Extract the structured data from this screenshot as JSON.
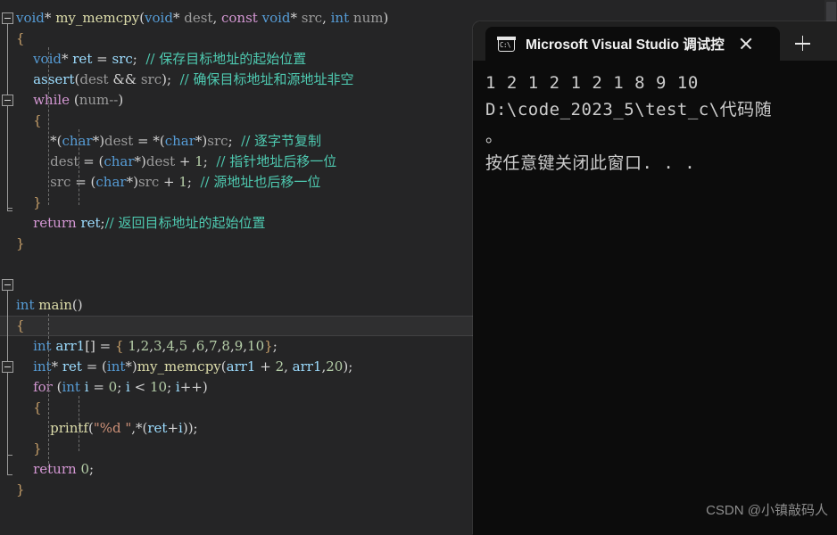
{
  "editor": {
    "name": "visual-studio-code-editor",
    "theme_background": "#252526",
    "current_line_index": 15,
    "lines": [
      {
        "indent": 0,
        "tokens": [
          {
            "c": "t-type",
            "s": "void"
          },
          {
            "c": "t-punct",
            "s": "* "
          },
          {
            "c": "t-fn",
            "s": "my_memcpy"
          },
          {
            "c": "t-punct",
            "s": "("
          },
          {
            "c": "t-type",
            "s": "void"
          },
          {
            "c": "t-punct",
            "s": "* "
          },
          {
            "c": "t-ident",
            "s": "dest"
          },
          {
            "c": "t-punct",
            "s": ", "
          },
          {
            "c": "t-key",
            "s": "const"
          },
          {
            "c": "t-punct",
            "s": " "
          },
          {
            "c": "t-type",
            "s": "void"
          },
          {
            "c": "t-punct",
            "s": "* "
          },
          {
            "c": "t-ident",
            "s": "src"
          },
          {
            "c": "t-punct",
            "s": ", "
          },
          {
            "c": "t-type",
            "s": "int"
          },
          {
            "c": "t-punct",
            "s": " "
          },
          {
            "c": "t-ident",
            "s": "num"
          },
          {
            "c": "t-punct",
            "s": ")"
          }
        ]
      },
      {
        "indent": 0,
        "tokens": [
          {
            "c": "t-brace",
            "s": "{"
          }
        ]
      },
      {
        "indent": 0,
        "tokens": [
          {
            "c": "t-punct",
            "s": "    "
          },
          {
            "c": "t-type",
            "s": "void"
          },
          {
            "c": "t-punct",
            "s": "* "
          },
          {
            "c": "t-var",
            "s": "ret"
          },
          {
            "c": "t-punct",
            "s": " = "
          },
          {
            "c": "t-var",
            "s": "src"
          },
          {
            "c": "t-punct",
            "s": ";  "
          },
          {
            "c": "t-cmt",
            "s": "// 保存目标地址的起始位置"
          }
        ]
      },
      {
        "indent": 0,
        "tokens": [
          {
            "c": "t-punct",
            "s": "    "
          },
          {
            "c": "t-var",
            "s": "assert"
          },
          {
            "c": "t-punct",
            "s": "("
          },
          {
            "c": "t-ident",
            "s": "dest"
          },
          {
            "c": "t-punct",
            "s": " && "
          },
          {
            "c": "t-ident",
            "s": "src"
          },
          {
            "c": "t-punct",
            "s": ");  "
          },
          {
            "c": "t-cmt",
            "s": "// 确保目标地址和源地址非空"
          }
        ]
      },
      {
        "indent": 0,
        "tokens": [
          {
            "c": "t-punct",
            "s": "    "
          },
          {
            "c": "t-key",
            "s": "while"
          },
          {
            "c": "t-punct",
            "s": " ("
          },
          {
            "c": "t-ident",
            "s": "num--"
          },
          {
            "c": "t-punct",
            "s": ")"
          }
        ]
      },
      {
        "indent": 0,
        "tokens": [
          {
            "c": "t-punct",
            "s": "    "
          },
          {
            "c": "t-brace",
            "s": "{"
          }
        ]
      },
      {
        "indent": 0,
        "tokens": [
          {
            "c": "t-punct",
            "s": "        *("
          },
          {
            "c": "t-type",
            "s": "char"
          },
          {
            "c": "t-punct",
            "s": "*)"
          },
          {
            "c": "t-ident",
            "s": "dest"
          },
          {
            "c": "t-punct",
            "s": " = *("
          },
          {
            "c": "t-type",
            "s": "char"
          },
          {
            "c": "t-punct",
            "s": "*)"
          },
          {
            "c": "t-ident",
            "s": "src"
          },
          {
            "c": "t-punct",
            "s": ";  "
          },
          {
            "c": "t-cmt",
            "s": "// 逐字节复制"
          }
        ]
      },
      {
        "indent": 0,
        "tokens": [
          {
            "c": "t-punct",
            "s": "        "
          },
          {
            "c": "t-ident",
            "s": "dest"
          },
          {
            "c": "t-punct",
            "s": " = ("
          },
          {
            "c": "t-type",
            "s": "char"
          },
          {
            "c": "t-punct",
            "s": "*)"
          },
          {
            "c": "t-ident",
            "s": "dest"
          },
          {
            "c": "t-punct",
            "s": " + "
          },
          {
            "c": "t-num",
            "s": "1"
          },
          {
            "c": "t-punct",
            "s": ";  "
          },
          {
            "c": "t-cmt",
            "s": "// 指针地址后移一位"
          }
        ]
      },
      {
        "indent": 0,
        "tokens": [
          {
            "c": "t-punct",
            "s": "        "
          },
          {
            "c": "t-ident",
            "s": "src"
          },
          {
            "c": "t-punct",
            "s": " = ("
          },
          {
            "c": "t-type",
            "s": "char"
          },
          {
            "c": "t-punct",
            "s": "*)"
          },
          {
            "c": "t-ident",
            "s": "src"
          },
          {
            "c": "t-punct",
            "s": " + "
          },
          {
            "c": "t-num",
            "s": "1"
          },
          {
            "c": "t-punct",
            "s": ";  "
          },
          {
            "c": "t-cmt",
            "s": "// 源地址也后移一位"
          }
        ]
      },
      {
        "indent": 0,
        "tokens": [
          {
            "c": "t-punct",
            "s": "    "
          },
          {
            "c": "t-brace",
            "s": "}"
          }
        ]
      },
      {
        "indent": 0,
        "tokens": [
          {
            "c": "t-punct",
            "s": "    "
          },
          {
            "c": "t-key",
            "s": "return"
          },
          {
            "c": "t-punct",
            "s": " "
          },
          {
            "c": "t-var",
            "s": "ret"
          },
          {
            "c": "t-punct",
            "s": ";"
          },
          {
            "c": "t-cmt",
            "s": "// 返回目标地址的起始位置"
          }
        ]
      },
      {
        "indent": 0,
        "tokens": [
          {
            "c": "t-brace",
            "s": "}"
          }
        ]
      },
      {
        "indent": 0,
        "tokens": []
      },
      {
        "indent": 0,
        "tokens": []
      },
      {
        "indent": 0,
        "tokens": [
          {
            "c": "t-type",
            "s": "int"
          },
          {
            "c": "t-punct",
            "s": " "
          },
          {
            "c": "t-fn",
            "s": "main"
          },
          {
            "c": "t-punct",
            "s": "()"
          }
        ]
      },
      {
        "indent": 0,
        "tokens": [
          {
            "c": "t-brace",
            "s": "{"
          }
        ]
      },
      {
        "indent": 0,
        "tokens": [
          {
            "c": "t-punct",
            "s": "    "
          },
          {
            "c": "t-type",
            "s": "int"
          },
          {
            "c": "t-punct",
            "s": " "
          },
          {
            "c": "t-var",
            "s": "arr1"
          },
          {
            "c": "t-punct",
            "s": "[] = "
          },
          {
            "c": "t-brace",
            "s": "{"
          },
          {
            "c": "t-punct",
            "s": " "
          },
          {
            "c": "t-num",
            "s": "1"
          },
          {
            "c": "t-punct",
            "s": ","
          },
          {
            "c": "t-num",
            "s": "2"
          },
          {
            "c": "t-punct",
            "s": ","
          },
          {
            "c": "t-num",
            "s": "3"
          },
          {
            "c": "t-punct",
            "s": ","
          },
          {
            "c": "t-num",
            "s": "4"
          },
          {
            "c": "t-punct",
            "s": ","
          },
          {
            "c": "t-num",
            "s": "5"
          },
          {
            "c": "t-punct",
            "s": " ,"
          },
          {
            "c": "t-num",
            "s": "6"
          },
          {
            "c": "t-punct",
            "s": ","
          },
          {
            "c": "t-num",
            "s": "7"
          },
          {
            "c": "t-punct",
            "s": ","
          },
          {
            "c": "t-num",
            "s": "8"
          },
          {
            "c": "t-punct",
            "s": ","
          },
          {
            "c": "t-num",
            "s": "9"
          },
          {
            "c": "t-punct",
            "s": ","
          },
          {
            "c": "t-num",
            "s": "10"
          },
          {
            "c": "t-brace",
            "s": "}"
          },
          {
            "c": "t-punct",
            "s": ";"
          }
        ]
      },
      {
        "indent": 0,
        "tokens": [
          {
            "c": "t-punct",
            "s": "    "
          },
          {
            "c": "t-type",
            "s": "int"
          },
          {
            "c": "t-punct",
            "s": "* "
          },
          {
            "c": "t-var",
            "s": "ret"
          },
          {
            "c": "t-punct",
            "s": " = ("
          },
          {
            "c": "t-type",
            "s": "int"
          },
          {
            "c": "t-punct",
            "s": "*)"
          },
          {
            "c": "t-fn",
            "s": "my_memcpy"
          },
          {
            "c": "t-punct",
            "s": "("
          },
          {
            "c": "t-var",
            "s": "arr1"
          },
          {
            "c": "t-punct",
            "s": " + "
          },
          {
            "c": "t-num",
            "s": "2"
          },
          {
            "c": "t-punct",
            "s": ", "
          },
          {
            "c": "t-var",
            "s": "arr1"
          },
          {
            "c": "t-punct",
            "s": ","
          },
          {
            "c": "t-num",
            "s": "20"
          },
          {
            "c": "t-punct",
            "s": ");"
          }
        ]
      },
      {
        "indent": 0,
        "tokens": [
          {
            "c": "t-punct",
            "s": "    "
          },
          {
            "c": "t-key",
            "s": "for"
          },
          {
            "c": "t-punct",
            "s": " ("
          },
          {
            "c": "t-type",
            "s": "int"
          },
          {
            "c": "t-punct",
            "s": " "
          },
          {
            "c": "t-var",
            "s": "i"
          },
          {
            "c": "t-punct",
            "s": " = "
          },
          {
            "c": "t-num",
            "s": "0"
          },
          {
            "c": "t-punct",
            "s": "; "
          },
          {
            "c": "t-var",
            "s": "i"
          },
          {
            "c": "t-punct",
            "s": " < "
          },
          {
            "c": "t-num",
            "s": "10"
          },
          {
            "c": "t-punct",
            "s": "; "
          },
          {
            "c": "t-var",
            "s": "i"
          },
          {
            "c": "t-punct",
            "s": "++)"
          }
        ]
      },
      {
        "indent": 0,
        "tokens": [
          {
            "c": "t-punct",
            "s": "    "
          },
          {
            "c": "t-brace",
            "s": "{"
          }
        ]
      },
      {
        "indent": 0,
        "tokens": [
          {
            "c": "t-punct",
            "s": "        "
          },
          {
            "c": "t-fn",
            "s": "printf"
          },
          {
            "c": "t-punct",
            "s": "("
          },
          {
            "c": "t-str",
            "s": "\"%d \""
          },
          {
            "c": "t-punct",
            "s": ",*("
          },
          {
            "c": "t-var",
            "s": "ret"
          },
          {
            "c": "t-punct",
            "s": "+"
          },
          {
            "c": "t-var",
            "s": "i"
          },
          {
            "c": "t-punct",
            "s": "));"
          }
        ]
      },
      {
        "indent": 0,
        "tokens": [
          {
            "c": "t-punct",
            "s": "    "
          },
          {
            "c": "t-brace",
            "s": "}"
          }
        ]
      },
      {
        "indent": 0,
        "tokens": [
          {
            "c": "t-punct",
            "s": "    "
          },
          {
            "c": "t-key",
            "s": "return"
          },
          {
            "c": "t-punct",
            "s": " "
          },
          {
            "c": "t-num",
            "s": "0"
          },
          {
            "c": "t-punct",
            "s": ";"
          }
        ]
      },
      {
        "indent": 0,
        "tokens": [
          {
            "c": "t-brace",
            "s": "}"
          }
        ]
      }
    ]
  },
  "console": {
    "window_name": "windows-terminal-debug-console",
    "tab": {
      "icon": "console-cmd-icon",
      "title": "Microsoft Visual Studio 调试控",
      "close_label": "×",
      "new_tab_label": "+"
    },
    "background": "#0c0c0c",
    "output_lines": [
      "1 2 1 2 1 2 1 8 9 10",
      "D:\\code_2023_5\\test_c\\代码随",
      "。",
      "按任意键关闭此窗口. . ."
    ]
  },
  "watermark": {
    "text": "CSDN @小镇敲码人"
  }
}
